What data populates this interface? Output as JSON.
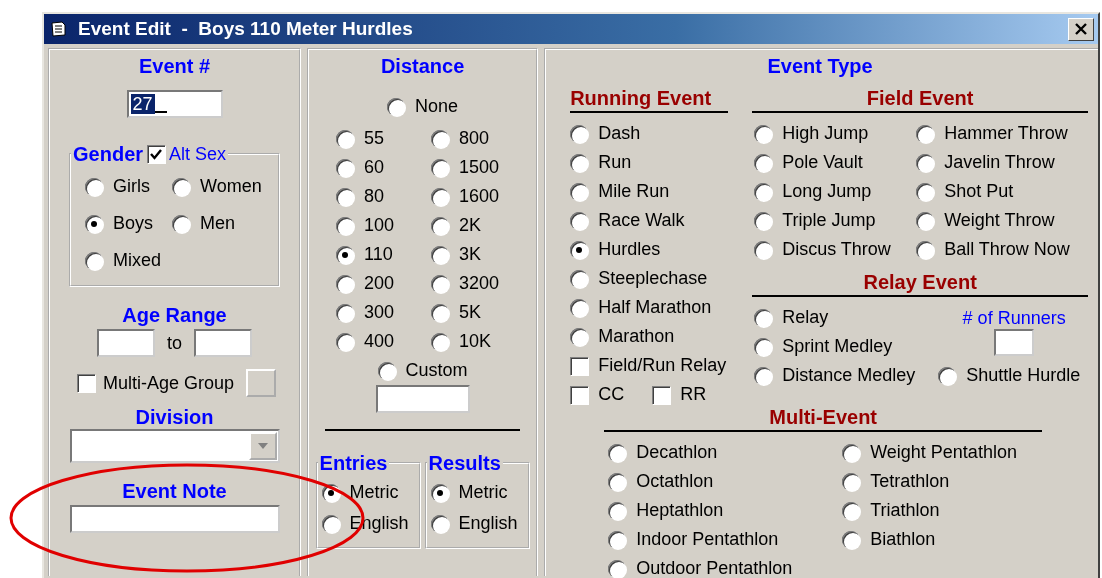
{
  "window": {
    "title": "Event Edit  -  Boys 110 Meter Hurdles"
  },
  "event_number": {
    "label": "Event #",
    "value": "27"
  },
  "gender": {
    "label": "Gender",
    "alt_sex": {
      "label": "Alt Sex",
      "checked": true
    },
    "options": [
      {
        "label": "Girls",
        "selected": false
      },
      {
        "label": "Women",
        "selected": false
      },
      {
        "label": "Boys",
        "selected": true
      },
      {
        "label": "Men",
        "selected": false
      },
      {
        "label": "Mixed",
        "selected": false
      }
    ]
  },
  "age_range": {
    "label": "Age Range",
    "separator": "to"
  },
  "multi_age_group": {
    "label": "Multi-Age Group",
    "checked": false
  },
  "division": {
    "label": "Division"
  },
  "event_note": {
    "label": "Event Note",
    "circled": true
  },
  "distance": {
    "label": "Distance",
    "none": {
      "label": "None",
      "selected": false
    },
    "options": [
      {
        "label": "55",
        "selected": false
      },
      {
        "label": "800",
        "selected": false
      },
      {
        "label": "60",
        "selected": false
      },
      {
        "label": "1500",
        "selected": false
      },
      {
        "label": "80",
        "selected": false
      },
      {
        "label": "1600",
        "selected": false
      },
      {
        "label": "100",
        "selected": false
      },
      {
        "label": "2K",
        "selected": false
      },
      {
        "label": "110",
        "selected": true
      },
      {
        "label": "3K",
        "selected": false
      },
      {
        "label": "200",
        "selected": false
      },
      {
        "label": "3200",
        "selected": false
      },
      {
        "label": "300",
        "selected": false
      },
      {
        "label": "5K",
        "selected": false
      },
      {
        "label": "400",
        "selected": false
      },
      {
        "label": "10K",
        "selected": false
      }
    ],
    "custom": {
      "label": "Custom",
      "selected": false
    }
  },
  "entries": {
    "label": "Entries",
    "options": [
      {
        "label": "Metric",
        "selected": true
      },
      {
        "label": "English",
        "selected": false
      }
    ]
  },
  "results": {
    "label": "Results",
    "options": [
      {
        "label": "Metric",
        "selected": true
      },
      {
        "label": "English",
        "selected": false
      }
    ]
  },
  "event_type": {
    "label": "Event Type",
    "running": {
      "label": "Running Event",
      "options": [
        {
          "label": "Dash",
          "selected": false
        },
        {
          "label": "Run",
          "selected": false
        },
        {
          "label": "Mile Run",
          "selected": false
        },
        {
          "label": "Race Walk",
          "selected": false
        },
        {
          "label": "Hurdles",
          "selected": true
        },
        {
          "label": "Steeplechase",
          "selected": false
        },
        {
          "label": "Half Marathon",
          "selected": false
        },
        {
          "label": "Marathon",
          "selected": false
        }
      ],
      "checkboxes": [
        {
          "label": "Field/Run Relay",
          "checked": false
        },
        {
          "label": "CC",
          "checked": false
        },
        {
          "label": "RR",
          "checked": false
        }
      ]
    },
    "field": {
      "label": "Field Event",
      "options": [
        {
          "label": "High Jump",
          "selected": false
        },
        {
          "label": "Hammer Throw",
          "selected": false
        },
        {
          "label": "Pole Vault",
          "selected": false
        },
        {
          "label": "Javelin Throw",
          "selected": false
        },
        {
          "label": "Long Jump",
          "selected": false
        },
        {
          "label": "Shot Put",
          "selected": false
        },
        {
          "label": "Triple Jump",
          "selected": false
        },
        {
          "label": "Weight Throw",
          "selected": false
        },
        {
          "label": "Discus Throw",
          "selected": false
        },
        {
          "label": "Ball Throw Now",
          "selected": false
        }
      ]
    },
    "relay": {
      "label": "Relay Event",
      "options": [
        {
          "label": "Relay",
          "selected": false
        },
        {
          "label": "Sprint Medley",
          "selected": false
        },
        {
          "label": "Distance Medley",
          "selected": false
        },
        {
          "label": "Shuttle Hurdle",
          "selected": false
        }
      ],
      "runners": {
        "label": "# of Runners"
      }
    },
    "multi": {
      "label": "Multi-Event",
      "options": [
        {
          "label": "Decathlon",
          "selected": false
        },
        {
          "label": "Weight Pentathlon",
          "selected": false
        },
        {
          "label": "Octathlon",
          "selected": false
        },
        {
          "label": "Tetrathlon",
          "selected": false
        },
        {
          "label": "Heptathlon",
          "selected": false
        },
        {
          "label": "Triathlon",
          "selected": false
        },
        {
          "label": "Indoor Pentathlon",
          "selected": false
        },
        {
          "label": "Biathlon",
          "selected": false
        },
        {
          "label": "Outdoor Pentathlon",
          "selected": false
        }
      ]
    }
  }
}
